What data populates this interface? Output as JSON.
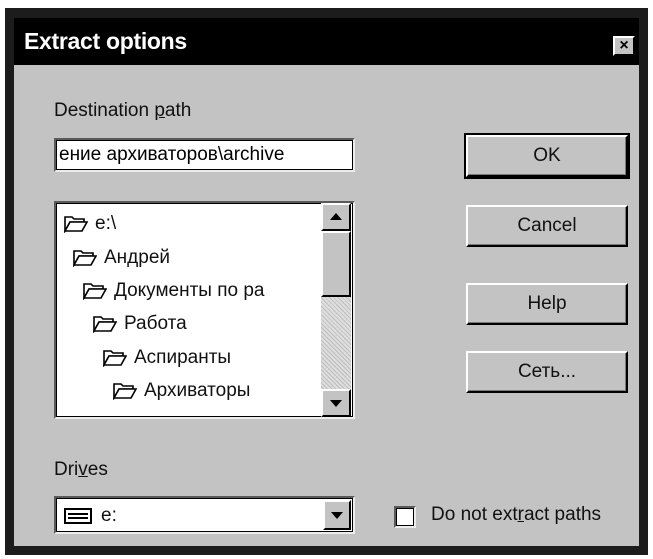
{
  "window": {
    "title": "Extract options",
    "close_glyph": "×"
  },
  "destination": {
    "label_pre": "Destination ",
    "label_ul": "p",
    "label_post": "ath",
    "value": "ение архиваторов\\archive"
  },
  "tree": {
    "items": [
      {
        "label": "e:\\",
        "icon": "open-folder-icon"
      },
      {
        "label": "Андрей",
        "icon": "open-folder-icon"
      },
      {
        "label": "Документы по ра",
        "icon": "open-folder-icon"
      },
      {
        "label": "Работа",
        "icon": "open-folder-icon"
      },
      {
        "label": "Аспиранты",
        "icon": "open-folder-icon"
      },
      {
        "label": "Архиваторы",
        "icon": "open-folder-icon"
      }
    ]
  },
  "buttons": {
    "ok": "OK",
    "cancel": "Cancel",
    "help": "Help",
    "network": "Сеть..."
  },
  "drives": {
    "label_pre": "Dri",
    "label_ul": "v",
    "label_post": "es",
    "selected": "e:",
    "icon": "drive-icon"
  },
  "extract_paths": {
    "label_pre": "Do not ext",
    "label_ul": "r",
    "label_post": "act paths",
    "checked": false
  }
}
